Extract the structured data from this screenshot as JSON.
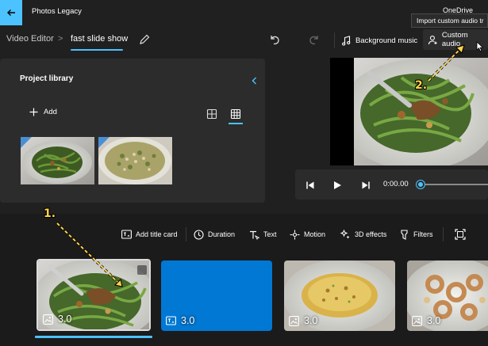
{
  "titlebar": {
    "app_title": "Photos Legacy",
    "onedrive_text": "OneDrive"
  },
  "toolbar": {
    "breadcrumb_root": "Video Editor",
    "breadcrumb_separator": ">",
    "project_name": "fast slide show",
    "background_music_label": "Background music",
    "custom_audio_label": "Custom audio",
    "tooltip": "Import custom audio tr"
  },
  "library": {
    "title": "Project library",
    "add_label": "Add"
  },
  "player": {
    "time": "0:00.00",
    "progress": 0
  },
  "storyboard": {
    "tools": {
      "add_title_card": "Add title card",
      "duration": "Duration",
      "text": "Text",
      "motion": "Motion",
      "effects_3d": "3D effects",
      "filters": "Filters"
    },
    "clips": [
      {
        "duration": "3.0"
      },
      {
        "duration": "3.0"
      },
      {
        "duration": "3.0"
      },
      {
        "duration": "3.0"
      }
    ]
  },
  "annotations": {
    "step1": "1.",
    "step2": "2."
  },
  "colors": {
    "accent": "#4cc2ff",
    "title_card_blue": "#0078d4",
    "annotation_yellow": "#ffd54a"
  }
}
